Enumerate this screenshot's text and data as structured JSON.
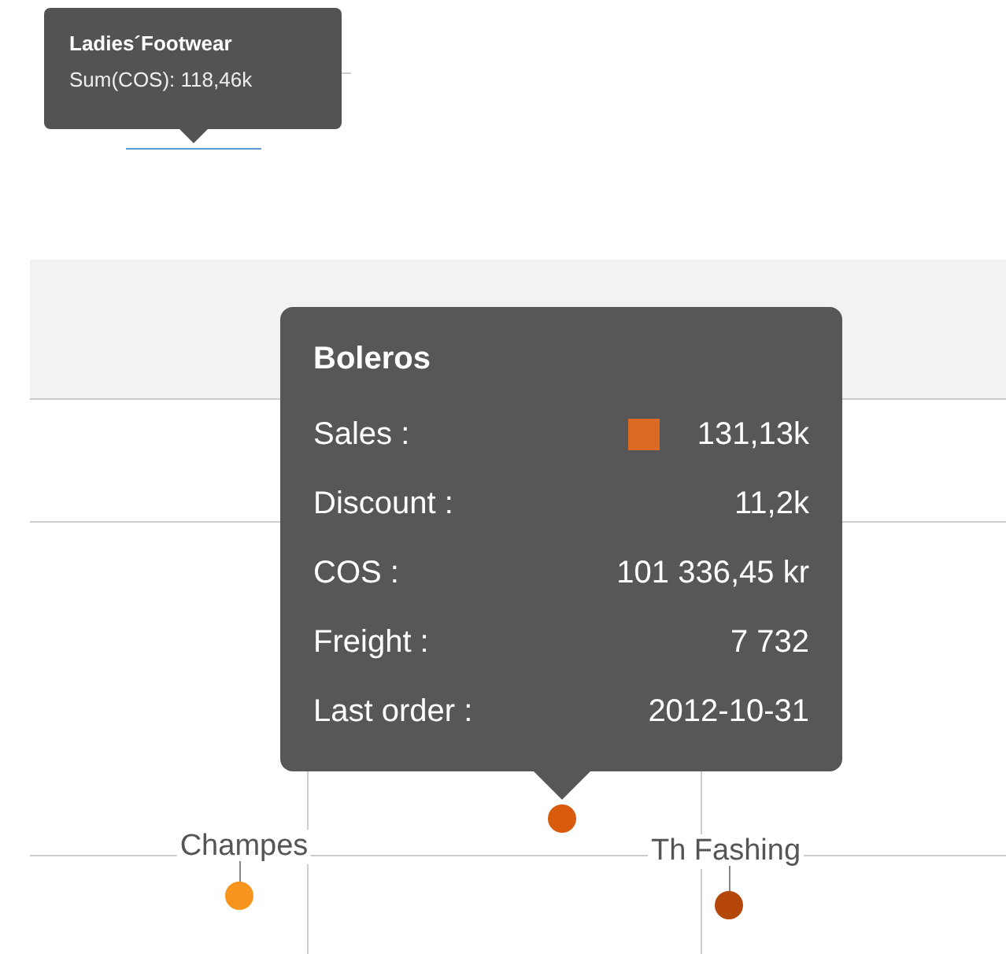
{
  "mini_tooltip": {
    "title": "Ladies´Footwear",
    "text": "Sum(COS): 118,46k"
  },
  "tooltip": {
    "title": "Boleros",
    "rows": [
      {
        "label": "Sales :",
        "value": "131,13k",
        "color": "#dd6a22"
      },
      {
        "label": "Discount :",
        "value": "11,2k"
      },
      {
        "label": "COS :",
        "value": "101 336,45 kr"
      },
      {
        "label": "Freight :",
        "value": "7 732"
      },
      {
        "label": "Last order :",
        "value": "2012-10-31"
      }
    ]
  },
  "points": [
    {
      "color": "#d95c0e"
    },
    {
      "label": "Champes",
      "color": "#f7941d"
    },
    {
      "label": "Th Fashing",
      "color": "#b5470b"
    }
  ]
}
